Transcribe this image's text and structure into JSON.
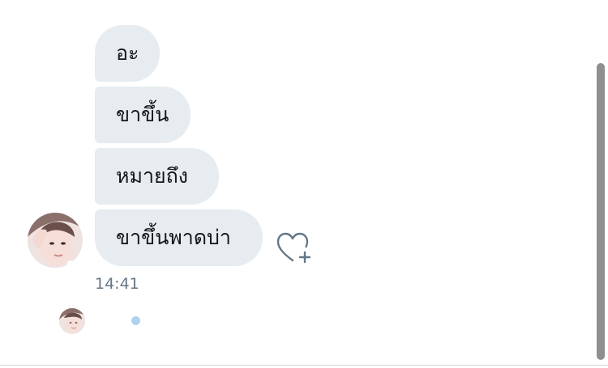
{
  "conversation": {
    "messages": [
      {
        "text": "อะ"
      },
      {
        "text": "ขาขึ้น"
      },
      {
        "text": "หมายถึง"
      },
      {
        "text": "ขาขึ้นพาดบ่า"
      }
    ],
    "timestamp": "14:41"
  },
  "icons": {
    "like": "heart-plus-icon",
    "avatar": "user-avatar",
    "typing": "typing-indicator-dot"
  },
  "colors": {
    "bubble_background": "#e6ecf0",
    "message_text": "#14171a",
    "timestamp_text": "#657786",
    "icon_stroke": "#657786",
    "typing_dot": "#aed3ef",
    "scrollbar": "#8f8f8f"
  }
}
